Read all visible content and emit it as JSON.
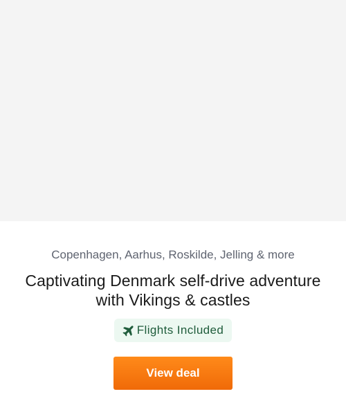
{
  "deal": {
    "locations": "Copenhagen, Aarhus, Roskilde, Jelling & more",
    "title": "Captivating Denmark self-drive adventure with Vikings & castles",
    "badge_label": "Flights Included",
    "badge_icon": "plane-icon",
    "cta_label": "View deal"
  },
  "colors": {
    "image_placeholder": "#f4f4f4",
    "badge_background": "#ecf8f1",
    "badge_text": "#1f5c3b",
    "cta_background": "#f47811",
    "cta_text": "#ffffff"
  }
}
